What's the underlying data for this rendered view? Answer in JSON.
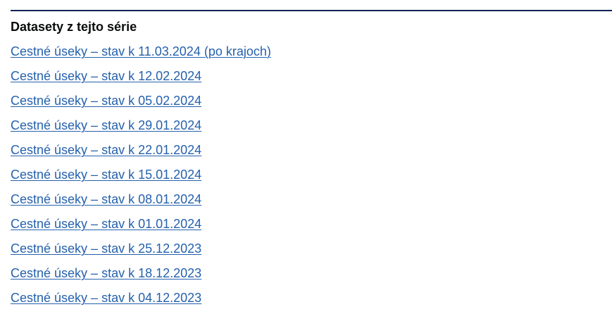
{
  "section": {
    "heading": "Datasety z tejto série",
    "links": [
      "Cestné úseky – stav k 11.03.2024 (po krajoch)",
      "Cestné úseky – stav k 12.02.2024",
      "Cestné úseky – stav k 05.02.2024",
      "Cestné úseky – stav k 29.01.2024",
      "Cestné úseky – stav k 22.01.2024",
      "Cestné úseky – stav k 15.01.2024",
      "Cestné úseky – stav k 08.01.2024",
      "Cestné úseky – stav k 01.01.2024",
      "Cestné úseky – stav k 25.12.2023",
      "Cestné úseky – stav k 18.12.2023",
      "Cestné úseky – stav k 04.12.2023"
    ]
  },
  "colors": {
    "rule": "#0b2454",
    "heading": "#0b0c0c",
    "link": "#2561ad"
  }
}
